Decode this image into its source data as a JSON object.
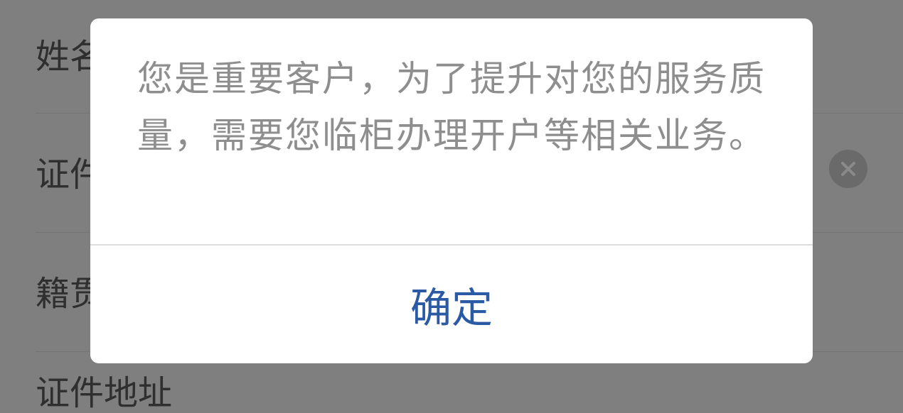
{
  "form": {
    "rows": [
      {
        "label": "姓名"
      },
      {
        "label": "证件"
      },
      {
        "label": "籍贯"
      },
      {
        "label": "证件地址"
      }
    ],
    "clear_icon": "clear-circle-icon"
  },
  "dialog": {
    "message": "您是重要客户，为了提升对您的服务质量，需要您临柜办理开户等相关业务。",
    "confirm_label": "确定"
  },
  "colors": {
    "accent": "#2b5aa5",
    "message_text": "#8e8e8e",
    "backdrop": "#7f7f7f"
  }
}
